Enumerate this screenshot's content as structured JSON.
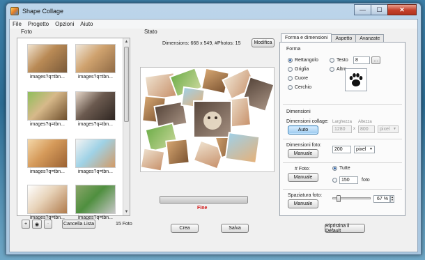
{
  "window": {
    "title": "Shape Collage",
    "minimize": "—",
    "maximize": "☐",
    "close": "✕"
  },
  "menu": [
    "File",
    "Progetto",
    "Opzioni",
    "Aiuto"
  ],
  "photos": {
    "section_label": "Foto",
    "items": [
      {
        "caption": "images?q=tbn...",
        "colors": [
          "#b98a55",
          "#7a5a3a",
          "#f1e4d0"
        ]
      },
      {
        "caption": "images?q=tbn...",
        "colors": [
          "#cfa26e",
          "#8f6a45",
          "#efe6d9"
        ]
      },
      {
        "caption": "images?q=tbn...",
        "colors": [
          "#d7b98a",
          "#6e4f2c",
          "#8fbe5a"
        ]
      },
      {
        "caption": "images?q=tbn...",
        "colors": [
          "#6b5a4f",
          "#2f2622",
          "#e5d6c8"
        ]
      },
      {
        "caption": "images?q=tbn...",
        "colors": [
          "#d59a5a",
          "#9b6233",
          "#f4d7a8"
        ]
      },
      {
        "caption": "images?q=tbn...",
        "colors": [
          "#9fd2e6",
          "#d39a66",
          "#f3f3f3"
        ]
      },
      {
        "caption": "images?q=tbn...",
        "colors": [
          "#e7d2b8",
          "#b07b4c",
          "#ffffff"
        ]
      },
      {
        "caption": "images?q=tbn...",
        "colors": [
          "#4f8f3f",
          "#c7c7c7",
          "#8aa56a"
        ]
      }
    ],
    "add_label": "+",
    "web_label": "◉",
    "remove_label": "-",
    "clear_label": "Cancella Lista",
    "count_label": "15 Foto"
  },
  "status": {
    "section_label": "Stato",
    "dimensions_text": "Dimensions: 668 x 549, #Photos: 15",
    "modify_label": "Modifica",
    "progress_fraction": 1.0,
    "progress_text": "Fine",
    "create_label": "Crea",
    "save_label": "Salva"
  },
  "settings": {
    "tabs": [
      {
        "label": "Forma e dimensioni",
        "active": true
      },
      {
        "label": "Aspetto",
        "active": false
      },
      {
        "label": "Avanzate",
        "active": false
      }
    ],
    "shape": {
      "group_label": "Forma",
      "options": [
        {
          "label": "Rettangolo",
          "selected": true
        },
        {
          "label": "Griglia",
          "selected": false
        },
        {
          "label": "Cuore",
          "selected": false
        },
        {
          "label": "Cerchio",
          "selected": false
        }
      ],
      "text_option": "Testo",
      "text_value": "8",
      "browse_label": "...",
      "other_option": "Altro"
    },
    "dimensions": {
      "group_label": "Dimensioni",
      "collage_label": "Dimensioni collage:",
      "auto_label": "Auto",
      "width_label": "Larghezza",
      "height_label": "Altezza",
      "width_value": "1280",
      "x_label": "x",
      "height_value": "800",
      "unit_value": "pixel",
      "photo_size_label": "Dimensioni foto:",
      "manual_label": "Manuale",
      "photo_size_value": "200",
      "photo_unit_value": "pixel",
      "num_photos_label": "# Foto:",
      "num_manual_label": "Manuale",
      "all_option": "Tutte",
      "count_value": "150",
      "count_unit": "foto",
      "spacing_label": "Spaziatura foto:",
      "spacing_manual_label": "Manuale",
      "spacing_value": "67 %",
      "spacing_fraction": 0.1
    },
    "reset_label": "Ripristina il Default"
  }
}
